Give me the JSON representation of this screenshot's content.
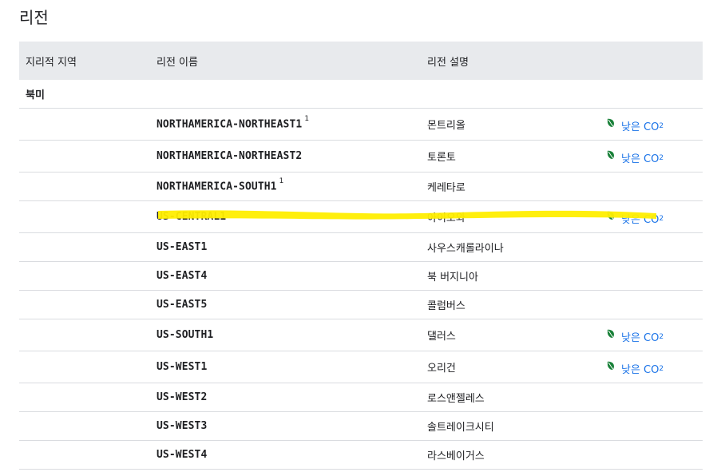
{
  "page": {
    "title": "리전"
  },
  "table": {
    "headers": [
      "지리적 지역",
      "리전 이름",
      "리전 설명",
      ""
    ],
    "group": "북미",
    "co2_label": "낮은 CO",
    "co2_sub": "2",
    "rows": [
      {
        "name": "NORTHAMERICA-NORTHEAST1",
        "footnote": "1",
        "description": "몬트리올",
        "low_co2": true
      },
      {
        "name": "NORTHAMERICA-NORTHEAST2",
        "footnote": "",
        "description": "토론토",
        "low_co2": true
      },
      {
        "name": "NORTHAMERICA-SOUTH1",
        "footnote": "1",
        "description": "케레타로",
        "low_co2": false
      },
      {
        "name": "US-CENTRAL1",
        "footnote": "",
        "description": "아이오와",
        "low_co2": true,
        "highlighted": true
      },
      {
        "name": "US-EAST1",
        "footnote": "",
        "description": "사우스캐롤라이나",
        "low_co2": false
      },
      {
        "name": "US-EAST4",
        "footnote": "",
        "description": "북 버지니아",
        "low_co2": false
      },
      {
        "name": "US-EAST5",
        "footnote": "",
        "description": "콜럼버스",
        "low_co2": false
      },
      {
        "name": "US-SOUTH1",
        "footnote": "",
        "description": "댈러스",
        "low_co2": true
      },
      {
        "name": "US-WEST1",
        "footnote": "",
        "description": "오리건",
        "low_co2": true
      },
      {
        "name": "US-WEST2",
        "footnote": "",
        "description": "로스앤젤레스",
        "low_co2": false
      },
      {
        "name": "US-WEST3",
        "footnote": "",
        "description": "솔트레이크시티",
        "low_co2": false
      },
      {
        "name": "US-WEST4",
        "footnote": "",
        "description": "라스베이거스",
        "low_co2": false
      }
    ]
  },
  "colors": {
    "header_bg": "#e8eaed",
    "link": "#1a73e8",
    "leaf": "#188038",
    "highlight": "#ffee00"
  },
  "icons": {
    "low_co2": "leaf-icon"
  }
}
